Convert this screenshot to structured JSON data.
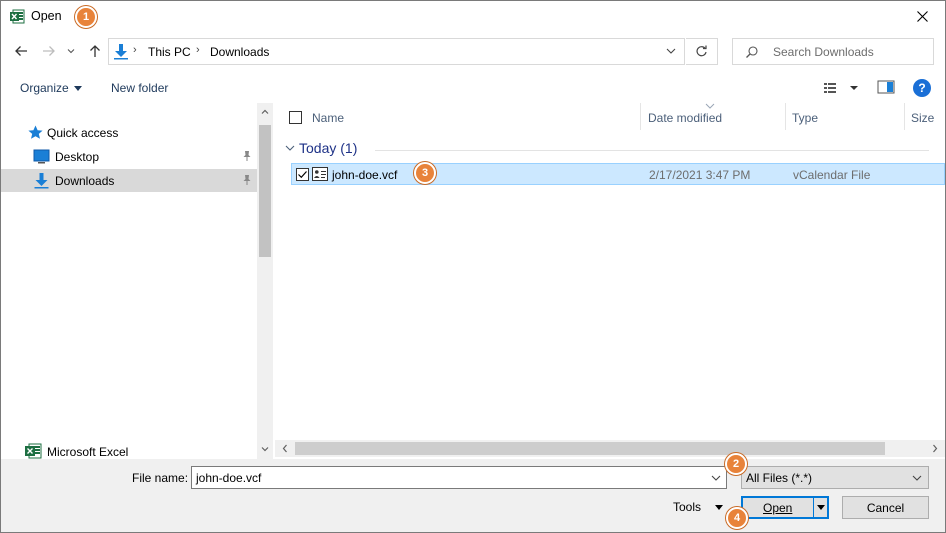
{
  "window": {
    "title": "Open",
    "app_icon": "excel-icon",
    "close_icon": "close-icon"
  },
  "callouts": [
    "1",
    "2",
    "3",
    "4"
  ],
  "nav": {
    "back_icon": "arrow-left-icon",
    "forward_icon": "arrow-right-icon",
    "recent_icon": "chevron-down-icon",
    "up_icon": "arrow-up-icon",
    "breadcrumbs": [
      "This PC",
      "Downloads"
    ],
    "refresh_icon": "refresh-icon",
    "search_placeholder": "Search Downloads"
  },
  "toolbar": {
    "organize_label": "Organize",
    "new_folder_label": "New folder",
    "view_icon": "details-view-icon",
    "preview_pane_icon": "preview-pane-icon",
    "help_label": "?"
  },
  "sidebar": {
    "items": [
      {
        "label": "Quick access",
        "icon": "star-icon",
        "pinned": false,
        "selected": false
      },
      {
        "label": "Desktop",
        "icon": "desktop-icon",
        "pinned": true,
        "selected": false
      },
      {
        "label": "Downloads",
        "icon": "download-icon",
        "pinned": true,
        "selected": true
      },
      {
        "label": "Microsoft Excel",
        "icon": "excel-icon",
        "pinned": false,
        "selected": false
      }
    ]
  },
  "file_list": {
    "columns": [
      "Name",
      "Date modified",
      "Type",
      "Size"
    ],
    "group_label": "Today (1)",
    "files": [
      {
        "name": "john-doe.vcf",
        "date_modified": "2/17/2021 3:47 PM",
        "type": "vCalendar File",
        "size": "",
        "selected": true,
        "checked": true
      }
    ]
  },
  "footer": {
    "file_name_label": "File name:",
    "file_name_value": "john-doe.vcf",
    "file_type_value": "All Files (*.*)",
    "tools_label": "Tools",
    "open_label": "Open",
    "cancel_label": "Cancel"
  },
  "colors": {
    "accent": "#0078d7",
    "selection": "#cce8ff",
    "callout": "#e8833a",
    "excel": "#1d6f42"
  }
}
